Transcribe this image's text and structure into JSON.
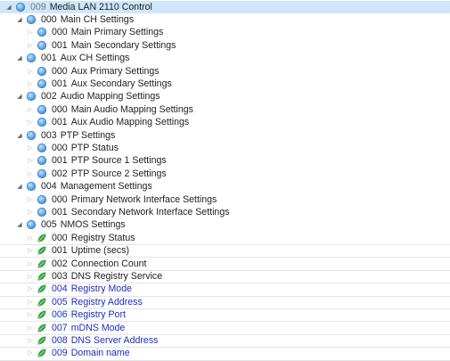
{
  "colors": {
    "folder_icon": "#3b8fd8",
    "param_icon": "#36a23b",
    "editable_text": "#1a2fbf",
    "selection_bg": "#cfe6fb"
  },
  "tree": [
    {
      "num": "009",
      "label": "Media LAN 2110 Control",
      "depth": 0,
      "icon": "folder-icon",
      "selected": true
    },
    {
      "num": "000",
      "label": "Main CH Settings",
      "depth": 1,
      "icon": "folder-icon"
    },
    {
      "num": "000",
      "label": "Main Primary Settings",
      "depth": 2,
      "icon": "folder-icon"
    },
    {
      "num": "001",
      "label": "Main Secondary Settings",
      "depth": 2,
      "icon": "folder-icon"
    },
    {
      "num": "001",
      "label": "Aux CH Settings",
      "depth": 1,
      "icon": "folder-icon"
    },
    {
      "num": "000",
      "label": "Aux Primary Settings",
      "depth": 2,
      "icon": "folder-icon"
    },
    {
      "num": "001",
      "label": "Aux Secondary Settings",
      "depth": 2,
      "icon": "folder-icon"
    },
    {
      "num": "002",
      "label": "Audio Mapping Settings",
      "depth": 1,
      "icon": "folder-icon"
    },
    {
      "num": "000",
      "label": "Main Audio Mapping Settings",
      "depth": 2,
      "icon": "folder-icon"
    },
    {
      "num": "001",
      "label": "Aux Audio Mapping Settings",
      "depth": 2,
      "icon": "folder-icon"
    },
    {
      "num": "003",
      "label": "PTP Settings",
      "depth": 1,
      "icon": "folder-icon"
    },
    {
      "num": "000",
      "label": "PTP Status",
      "depth": 2,
      "icon": "folder-icon"
    },
    {
      "num": "001",
      "label": "PTP Source 1 Settings",
      "depth": 2,
      "icon": "folder-icon"
    },
    {
      "num": "002",
      "label": "PTP Source 2 Settings",
      "depth": 2,
      "icon": "folder-icon"
    },
    {
      "num": "004",
      "label": "Management Settings",
      "depth": 1,
      "icon": "folder-icon"
    },
    {
      "num": "000",
      "label": "Primary Network Interface Settings",
      "depth": 2,
      "icon": "folder-icon"
    },
    {
      "num": "001",
      "label": "Secondary Network Interface Settings",
      "depth": 2,
      "icon": "folder-icon"
    },
    {
      "num": "005",
      "label": "NMOS Settings",
      "depth": 1,
      "icon": "folder-icon"
    },
    {
      "num": "000",
      "label": "Registry Status",
      "depth": 2,
      "icon": "leaf-icon"
    },
    {
      "num": "001",
      "label": "Uptime (secs)",
      "depth": 2,
      "icon": "leaf-icon"
    },
    {
      "num": "002",
      "label": "Connection Count",
      "depth": 2,
      "icon": "leaf-icon"
    },
    {
      "num": "003",
      "label": "DNS Registry Service",
      "depth": 2,
      "icon": "leaf-icon"
    },
    {
      "num": "004",
      "label": "Registry Mode",
      "depth": 2,
      "icon": "leaf-icon",
      "editable": true
    },
    {
      "num": "005",
      "label": "Registry Address",
      "depth": 2,
      "icon": "leaf-icon",
      "editable": true
    },
    {
      "num": "006",
      "label": "Registry Port",
      "depth": 2,
      "icon": "leaf-icon",
      "editable": true
    },
    {
      "num": "007",
      "label": "mDNS Mode",
      "depth": 2,
      "icon": "leaf-icon",
      "editable": true
    },
    {
      "num": "008",
      "label": "DNS Server Address",
      "depth": 2,
      "icon": "leaf-icon",
      "editable": true
    },
    {
      "num": "009",
      "label": "Domain name",
      "depth": 2,
      "icon": "leaf-icon",
      "editable": true
    }
  ]
}
